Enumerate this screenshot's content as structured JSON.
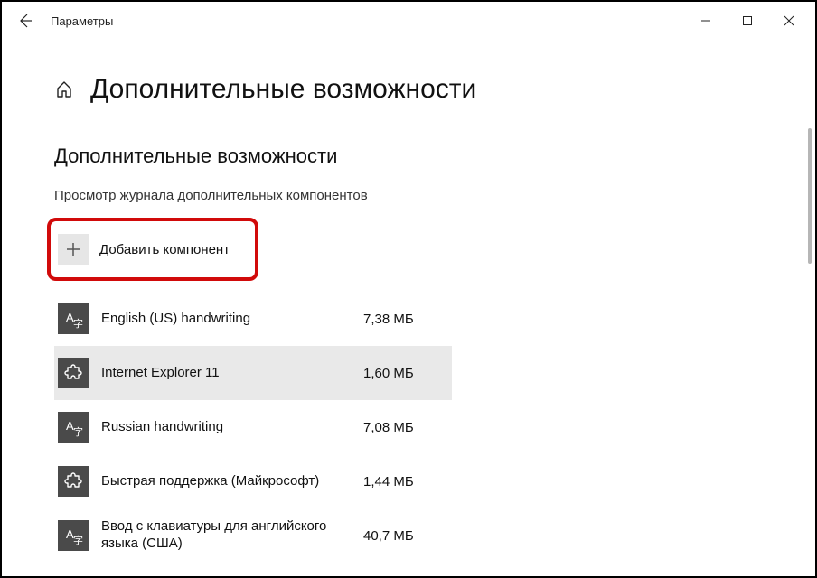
{
  "window": {
    "title": "Параметры"
  },
  "page": {
    "title": "Дополнительные возможности",
    "section_title": "Дополнительные возможности",
    "history_link": "Просмотр журнала дополнительных компонентов",
    "add_label": "Добавить компонент"
  },
  "features": [
    {
      "name": "English (US) handwriting",
      "size": "7,38 МБ",
      "icon": "lang"
    },
    {
      "name": "Internet Explorer 11",
      "size": "1,60 МБ",
      "icon": "puzzle",
      "hover": true
    },
    {
      "name": "Russian handwriting",
      "size": "7,08 МБ",
      "icon": "lang"
    },
    {
      "name": "Быстрая поддержка (Майкрософт)",
      "size": "1,44 МБ",
      "icon": "puzzle"
    },
    {
      "name": "Ввод с клавиатуры для английского языка (США)",
      "size": "40,7 МБ",
      "icon": "lang"
    }
  ]
}
